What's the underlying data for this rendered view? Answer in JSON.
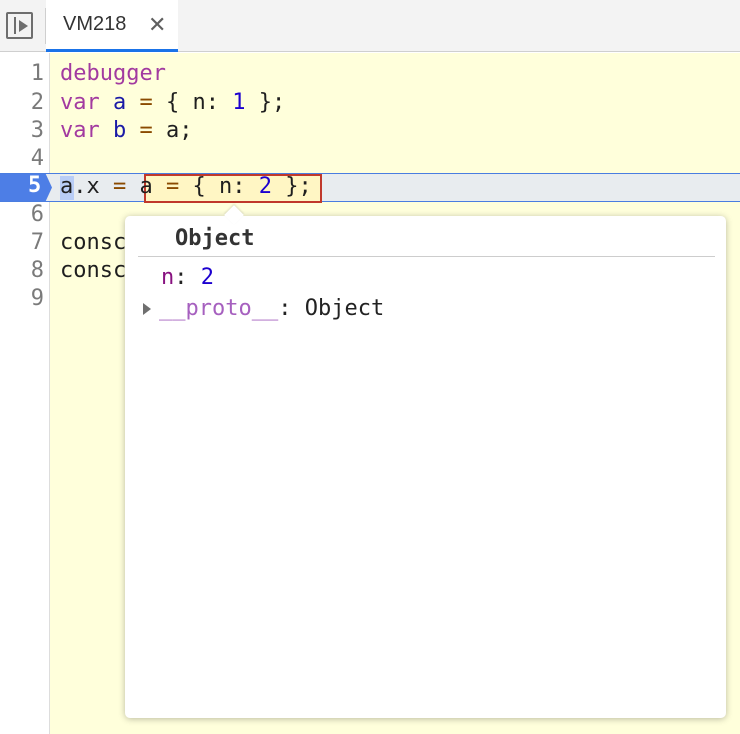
{
  "tab": {
    "title": "VM218",
    "close_symbol": "✕"
  },
  "gutter": {
    "numbers": [
      "1",
      "2",
      "3",
      "4",
      "5",
      "6",
      "7",
      "8",
      "9"
    ],
    "paused_line": "5"
  },
  "code": {
    "l1": {
      "kw": "debugger"
    },
    "l2": {
      "kw": "var",
      "var": "a",
      "op": "=",
      "open": "{ n:",
      "num": "1",
      "close": "};"
    },
    "l3": {
      "kw": "var",
      "var": "b",
      "op": "=",
      "rest": "a;"
    },
    "l5": {
      "obj": "a",
      "dot": ".",
      "prop": "x",
      "op": "=",
      "expr_a": "a",
      "expr_op": "=",
      "expr_open": "{ n:",
      "expr_num": "2",
      "expr_close": "}",
      "end": ";"
    },
    "l7": {
      "text": "consc"
    },
    "l8": {
      "text": "consc"
    }
  },
  "popover": {
    "title": "Object",
    "n_key": "n",
    "n_value": "2",
    "proto_key": "__proto__",
    "proto_value": "Object"
  }
}
